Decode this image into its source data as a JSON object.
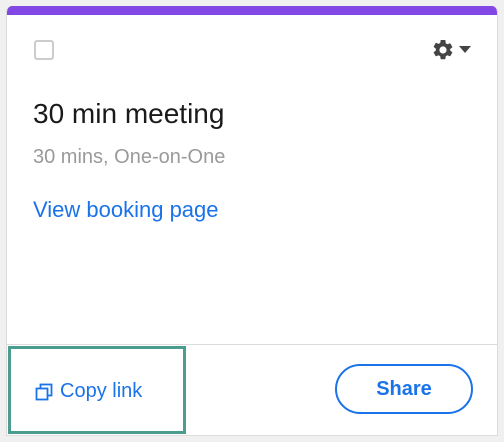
{
  "card": {
    "accent_color": "#8247e5",
    "title": "30 min meeting",
    "subtitle": "30 mins, One-on-One",
    "view_link_label": "View booking page",
    "settings_icon": "gear-icon",
    "settings_dropdown_icon": "caret-down-icon"
  },
  "footer": {
    "copy_link_label": "Copy link",
    "copy_icon": "copy-icon",
    "share_label": "Share",
    "link_color": "#1a73e8",
    "highlight_color": "#4a9d8f"
  }
}
